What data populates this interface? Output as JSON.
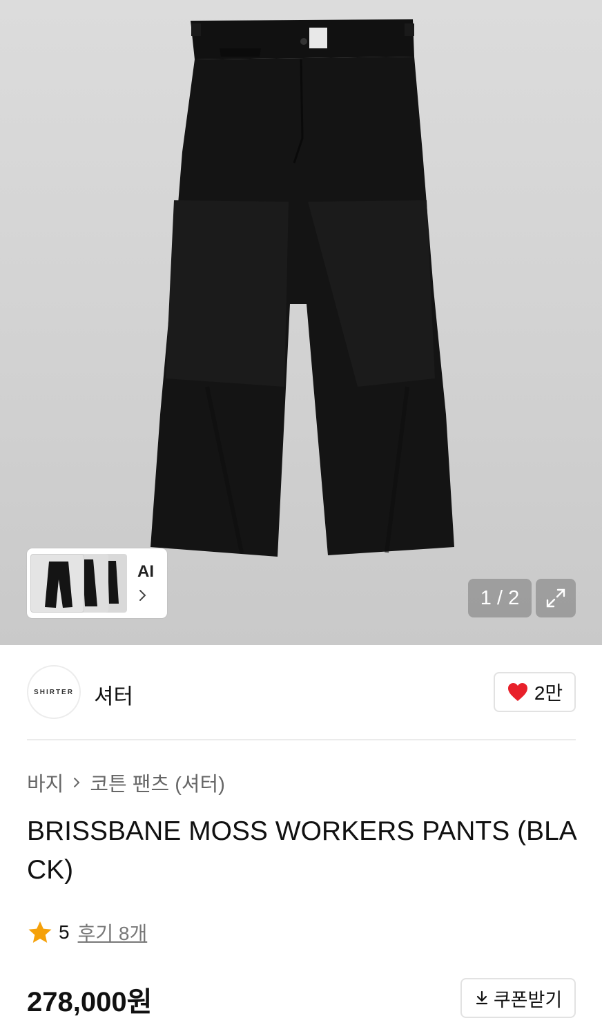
{
  "gallery": {
    "ai_label": "AI",
    "pager": "1 / 2"
  },
  "brand": {
    "logo_text": "SHIRTER",
    "name": "셔터",
    "like_count": "2만"
  },
  "breadcrumb": {
    "category": "바지",
    "subcategory": "코튼 팬츠 (셔터)"
  },
  "product": {
    "title": "BRISSBANE MOSS WORKERS PANTS (BLACK)",
    "rating": "5",
    "reviews": "후기 8개",
    "price": "278,000원",
    "coupon_label": "쿠폰받기"
  },
  "colors": {
    "heart": "#e8202a",
    "star": "#f5a10a",
    "pants": "#141414"
  },
  "icons": [
    "chevron-right-icon",
    "expand-icon",
    "heart-icon",
    "star-icon",
    "download-icon"
  ]
}
